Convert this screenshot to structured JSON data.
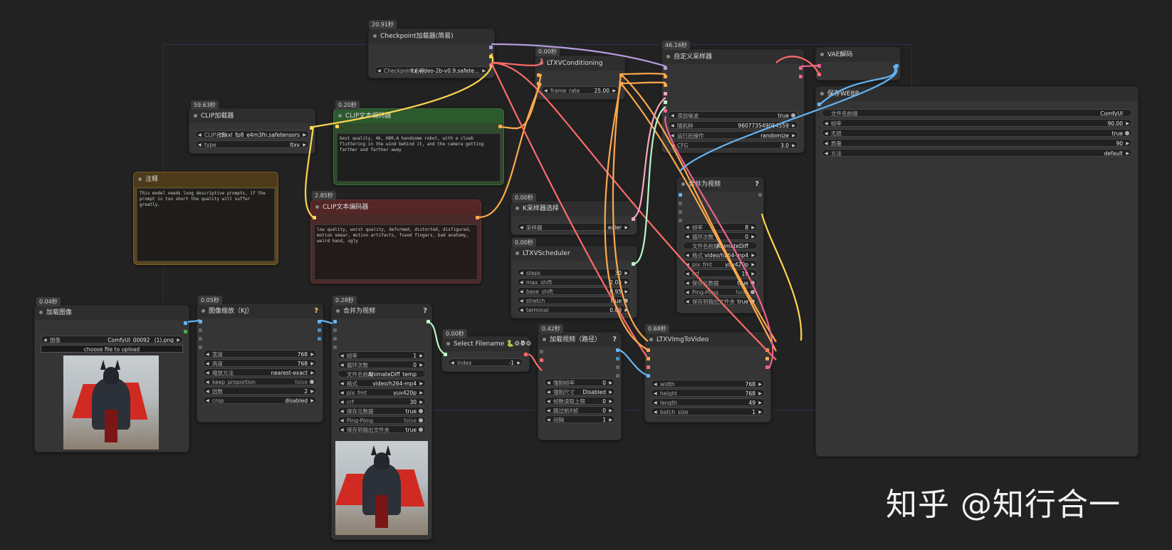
{
  "checkpoint": {
    "time": "20.91秒",
    "title": "Checkpoint加载器(简易)",
    "label": "Checkpoint名称",
    "value": "ltx-video-2b-v0.9.safete..."
  },
  "ltxv_cond": {
    "time": "0.00秒",
    "title": "LTXVConditioning",
    "label": "frame_rate",
    "value": "25.00"
  },
  "sampler": {
    "time": "46.16秒",
    "title": "自定义采样器",
    "rows": [
      {
        "label": "添加噪波",
        "value": "true",
        "toggle": true
      },
      {
        "label": "随机种",
        "value": "960773549054559"
      },
      {
        "label": "运行后操作",
        "value": "randomize"
      },
      {
        "label": "CFG",
        "value": "3.0"
      }
    ]
  },
  "vae": {
    "title": "VAE解码"
  },
  "save_webp": {
    "title": "保存WEBP",
    "rows": [
      {
        "label": "文件名前缀",
        "value": "ComfyUI",
        "plain": true
      },
      {
        "label": "帧率",
        "value": "90.00"
      },
      {
        "label": "无损",
        "value": "true",
        "toggle": true
      },
      {
        "label": "质量",
        "value": "90"
      },
      {
        "label": "方法",
        "value": "default"
      }
    ]
  },
  "clip_loader": {
    "time": "59.63秒",
    "title": "CLIP加载器",
    "rows": [
      {
        "label": "CLIP名称",
        "value": "t5xxl_fp8_e4m3fn.safetensors"
      },
      {
        "label": "type",
        "value": "ltxv"
      }
    ]
  },
  "clip_pos": {
    "time": "0.20秒",
    "title": "CLIP文本编码器",
    "text": "best quality, 4k, HDR,A handsome robot, with a cloak fluttering in the wind behind it, and the camera getting farther and farther away"
  },
  "note": {
    "title": "注释",
    "text": "This model needs long descriptive prompts, if the prompt is too short the quality will suffer greatly."
  },
  "clip_neg": {
    "time": "2.85秒",
    "title": "CLIP文本编码器",
    "text": "low quality, worst quality, deformed, distorted, disfigured, motion smear, motion artifacts, fused fingers, bad anatomy, weird hand, ugly"
  },
  "ksampler_select": {
    "time": "0.00秒",
    "title": "K采样器选择",
    "label": "采样器",
    "value": "euler"
  },
  "scheduler": {
    "time": "0.00秒",
    "title": "LTXVScheduler",
    "rows": [
      {
        "label": "steps",
        "value": "30"
      },
      {
        "label": "max_shift",
        "value": "2.05"
      },
      {
        "label": "base_shift",
        "value": "0.95"
      },
      {
        "label": "stretch",
        "value": "true",
        "toggle": true
      },
      {
        "label": "terminal",
        "value": "0.09"
      }
    ]
  },
  "combine_right": {
    "title": "合并为视频",
    "q": "?",
    "rows": [
      {
        "label": "帧率",
        "value": "8"
      },
      {
        "label": "循环次数",
        "value": "0"
      },
      {
        "label": "文件名前缀",
        "value": "AnimateDiff",
        "plain": true
      },
      {
        "label": "格式",
        "value": "video/h264-mp4"
      },
      {
        "label": "pix_fmt",
        "value": "yuv420p"
      },
      {
        "label": "crf",
        "value": "19"
      },
      {
        "label": "保存元数据",
        "value": "true",
        "toggle": true
      },
      {
        "label": "Ping-Pong",
        "value": "false",
        "toggle": true,
        "off": true
      },
      {
        "label": "保存到输出文件夹",
        "value": "true",
        "toggle": true
      }
    ]
  },
  "load_image": {
    "time": "0.04秒",
    "title": "加载图像",
    "label": "图像",
    "value": "ComfyUI_00092_ (1).png",
    "upload": "choose file to upload"
  },
  "resize": {
    "time": "0.05秒",
    "title": "图像缩放（KJ）",
    "q": "?",
    "rows": [
      {
        "label": "宽度",
        "value": "768"
      },
      {
        "label": "高度",
        "value": "768"
      },
      {
        "label": "缩放方法",
        "value": "nearest-exact"
      },
      {
        "label": "keep_proportion",
        "value": "false",
        "toggle": true,
        "off": true
      },
      {
        "label": "因数",
        "value": "2"
      },
      {
        "label": "crop",
        "value": "disabled"
      }
    ]
  },
  "combine_mid": {
    "time": "0.28秒",
    "title": "合并为视频",
    "q": "?",
    "rows": [
      {
        "label": "帧率",
        "value": "1"
      },
      {
        "label": "循环次数",
        "value": "0"
      },
      {
        "label": "文件名前缀",
        "value": "AnimateDiff_temp",
        "plain": true
      },
      {
        "label": "格式",
        "value": "video/h264-mp4"
      },
      {
        "label": "pix_fmt",
        "value": "yuv420p"
      },
      {
        "label": "crf",
        "value": "30"
      },
      {
        "label": "保存元数据",
        "value": "true",
        "toggle": true
      },
      {
        "label": "Ping-Pong",
        "value": "false",
        "toggle": true,
        "off": true
      },
      {
        "label": "保存到输出文件夹",
        "value": "true",
        "toggle": true
      }
    ]
  },
  "select_filename": {
    "time": "0.00秒",
    "title": "Select Filename 🐍⚙⚙⚙",
    "q": "?",
    "label": "index",
    "value": "-1"
  },
  "load_video": {
    "time": "0.42秒",
    "title": "加载视频（路径）",
    "q": "?",
    "rows": [
      {
        "label": "强制帧率",
        "value": "0"
      },
      {
        "label": "强制尺寸",
        "value": "Disabled"
      },
      {
        "label": "帧数读取上限",
        "value": "0"
      },
      {
        "label": "跳过前X帧",
        "value": "0"
      },
      {
        "label": "间隔",
        "value": "1"
      }
    ]
  },
  "img2video": {
    "time": "0.68秒",
    "title": "LTXVImgToVideo",
    "rows": [
      {
        "label": "width",
        "value": "768"
      },
      {
        "label": "height",
        "value": "768"
      },
      {
        "label": "length",
        "value": "49"
      },
      {
        "label": "batch_size",
        "value": "1"
      }
    ]
  },
  "watermark": "知乎 @知行合一"
}
